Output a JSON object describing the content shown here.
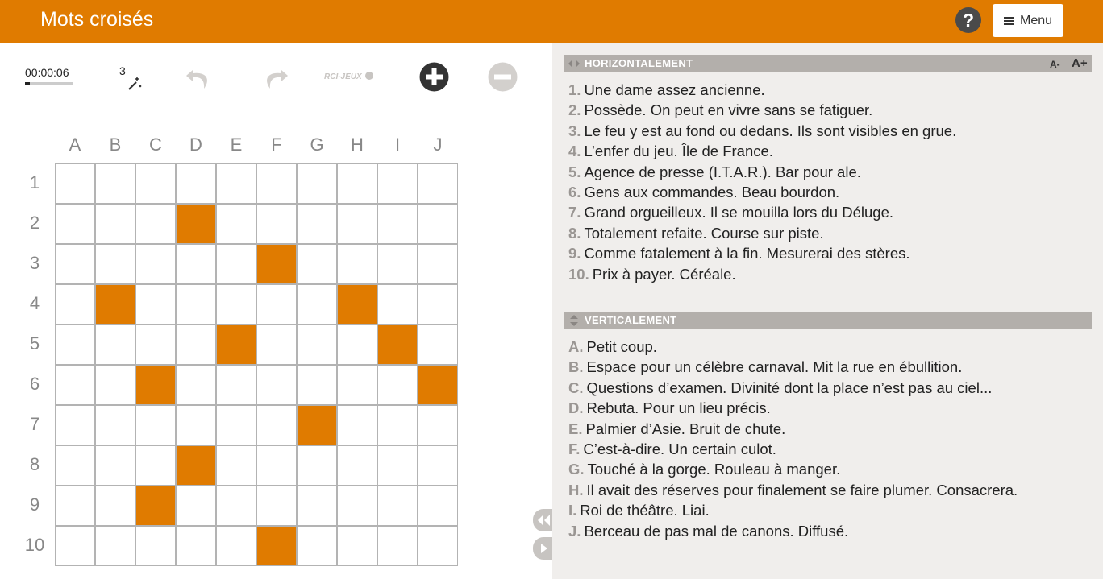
{
  "header": {
    "title": "Mots croisés",
    "help_label": "?",
    "menu_label": "Menu"
  },
  "toolbar": {
    "timer": "00:00:06",
    "timer_progress": 0.1,
    "hint_count": "3",
    "icons": [
      "magic-wand-icon",
      "undo-icon",
      "redo-icon",
      "rci-jeux-logo",
      "zoom-in-icon",
      "zoom-out-icon"
    ],
    "brand": "RCI-JEUX"
  },
  "grid": {
    "columns": [
      "A",
      "B",
      "C",
      "D",
      "E",
      "F",
      "G",
      "H",
      "I",
      "J"
    ],
    "rows": [
      "1",
      "2",
      "3",
      "4",
      "5",
      "6",
      "7",
      "8",
      "9",
      "10"
    ],
    "black_cells": [
      [
        2,
        4
      ],
      [
        3,
        6
      ],
      [
        4,
        2
      ],
      [
        4,
        8
      ],
      [
        5,
        5
      ],
      [
        5,
        9
      ],
      [
        6,
        3
      ],
      [
        6,
        10
      ],
      [
        7,
        7
      ],
      [
        8,
        4
      ],
      [
        9,
        3
      ],
      [
        10,
        6
      ]
    ]
  },
  "clues": {
    "horizontal": {
      "title": "HORIZONTALEMENT",
      "font_minus": "A-",
      "font_plus": "A+",
      "items": [
        {
          "num": "1.",
          "text": "Une dame assez ancienne."
        },
        {
          "num": "2.",
          "text": "Possède. On peut en vivre sans se fatiguer."
        },
        {
          "num": "3.",
          "text": "Le feu y est au fond ou dedans. Ils sont visibles en grue."
        },
        {
          "num": "4.",
          "text": "L’enfer du jeu. Île de France."
        },
        {
          "num": "5.",
          "text": "Agence de presse (I.T.A.R.). Bar pour ale."
        },
        {
          "num": "6.",
          "text": "Gens aux commandes. Beau bourdon."
        },
        {
          "num": "7.",
          "text": "Grand orgueilleux. Il se mouilla lors du Déluge."
        },
        {
          "num": "8.",
          "text": "Totalement refaite. Course sur piste."
        },
        {
          "num": "9.",
          "text": "Comme fatalement à la fin. Mesurerai des stères."
        },
        {
          "num": "10.",
          "text": "Prix à payer. Céréale."
        }
      ]
    },
    "vertical": {
      "title": "VERTICALEMENT",
      "items": [
        {
          "num": "A.",
          "text": "Petit coup."
        },
        {
          "num": "B.",
          "text": "Espace pour un célèbre carnaval. Mit la rue en ébullition."
        },
        {
          "num": "C.",
          "text": "Questions d’examen. Divinité dont la place n’est pas au ciel..."
        },
        {
          "num": "D.",
          "text": "Rebuta. Pour un lieu précis."
        },
        {
          "num": "E.",
          "text": "Palmier d’Asie. Bruit de chute."
        },
        {
          "num": "F.",
          "text": "C’est-à-dire. Un certain culot."
        },
        {
          "num": "G.",
          "text": "Touché à la gorge. Rouleau à manger."
        },
        {
          "num": "H.",
          "text": "Il avait des réserves pour finalement se faire plumer. Consacrera."
        },
        {
          "num": "I.",
          "text": "Roi de théâtre. Liai."
        },
        {
          "num": "J.",
          "text": "Berceau de pas mal de canons. Diffusé."
        }
      ]
    }
  },
  "colors": {
    "accent": "#e07b00",
    "header_bar": "#b3afab",
    "panel_bg": "#f0eeec"
  }
}
